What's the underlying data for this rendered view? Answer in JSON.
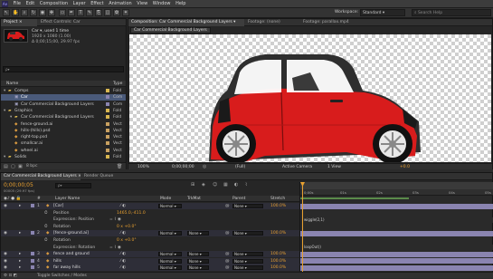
{
  "menu": {
    "logo": "Ae",
    "items": [
      "File",
      "Edit",
      "Composition",
      "Layer",
      "Effect",
      "Animation",
      "View",
      "Window",
      "Help"
    ]
  },
  "toolbar": {
    "workspace_label": "Workspace:",
    "workspace_value": "Standard",
    "search_placeholder": "Search Help"
  },
  "project": {
    "tabs": [
      "Project ×",
      "Effect Controls: Car"
    ],
    "selected_name": "Car ▾, used 1 time",
    "selected_dims": "1920 x 1080 (1.00)",
    "selected_duration": "Δ 0;00;15;00, 29.97 fps",
    "search_placeholder": "ρ▾",
    "col_name": "Name",
    "col_type": "Type",
    "items": [
      {
        "indent": 0,
        "kind": "folder",
        "name": "Comps",
        "type": "Fold"
      },
      {
        "indent": 1,
        "kind": "comp",
        "name": "Car",
        "type": "Com",
        "selected": true
      },
      {
        "indent": 1,
        "kind": "comp",
        "name": "Car Commercial Background Layers",
        "type": "Com"
      },
      {
        "indent": 0,
        "kind": "folder",
        "name": "Graphics",
        "type": "Fold"
      },
      {
        "indent": 1,
        "kind": "folder",
        "name": "Car Commercial Background Layers",
        "type": "Fold"
      },
      {
        "indent": 1,
        "kind": "file",
        "name": "fence-ground.ai",
        "type": "Vect"
      },
      {
        "indent": 1,
        "kind": "file",
        "name": "hills-(hills).psd",
        "type": "Vect"
      },
      {
        "indent": 1,
        "kind": "file",
        "name": "right-top.psd",
        "type": "Vect"
      },
      {
        "indent": 1,
        "kind": "file",
        "name": "smallcar.ai",
        "type": "Vect"
      },
      {
        "indent": 1,
        "kind": "file",
        "name": "wheel.ai",
        "type": "Vect"
      },
      {
        "indent": 0,
        "kind": "folder",
        "name": "Solids",
        "type": "Fold"
      }
    ],
    "bpc": "8 bpc"
  },
  "viewer": {
    "tabs": [
      "Composition: Car Commercial Background Layers ▾",
      "Footage: (none)",
      "Footage: parallax.mp4"
    ],
    "breadcrumb": "Car Commercial Background Layers",
    "zoom": "100%",
    "timecode": "0;00;00;00",
    "quality": "(Full)",
    "camera": "Active Camera",
    "views": "1 View",
    "offset": "+0.0"
  },
  "timeline": {
    "tabs": [
      "Car Commercial Background Layers ×",
      "Render Queue"
    ],
    "timecode": "0;00;00;05",
    "frames": "00005 (29.97 fps)",
    "search_placeholder": "ρ▾",
    "col_num": "#",
    "col_layer_name": "Layer Name",
    "col_mode": "Mode",
    "col_trkmat": "TrkMat",
    "col_parent": "Parent",
    "col_stretch": "Stretch",
    "ruler": [
      "0;00s",
      "01s",
      "02s",
      "03s",
      "04s",
      "05s"
    ],
    "rows": [
      {
        "kind": "layer",
        "num": "1",
        "name": "[Car]",
        "mode": "Normal ▾",
        "parent": "None ▾",
        "stretch": "100.0%"
      },
      {
        "kind": "prop",
        "name": "Position",
        "value": "1465.0,-411.0",
        "orange": true
      },
      {
        "kind": "expr",
        "name": "Expression: Position",
        "expr": "wiggle(2,1)"
      },
      {
        "kind": "prop",
        "name": "Rotation",
        "value": "0 x +0.0°",
        "orange": true
      },
      {
        "kind": "layer",
        "num": "2",
        "name": "[fence-ground.ai]",
        "mode": "Normal ▾",
        "trk": "None ▾",
        "parent": "None ▾",
        "stretch": "100.0%"
      },
      {
        "kind": "prop",
        "name": "Rotation",
        "value": "0 x +0.0°",
        "orange": true
      },
      {
        "kind": "expr",
        "name": "Expression: Rotation",
        "expr": "loopOut()"
      },
      {
        "kind": "layer",
        "num": "3",
        "name": "fence and ground",
        "mode": "Normal ▾",
        "trk": "None ▾",
        "parent": "None ▾",
        "stretch": "100.0%"
      },
      {
        "kind": "layer",
        "num": "4",
        "name": "hills",
        "mode": "Normal ▾",
        "trk": "None ▾",
        "parent": "None ▾",
        "stretch": "100.0%"
      },
      {
        "kind": "layer",
        "num": "5",
        "name": "far away hills",
        "mode": "Normal ▾",
        "trk": "None ▾",
        "parent": "None ▾",
        "stretch": "100.0%"
      }
    ],
    "footer": "Toggle Switches / Modes"
  },
  "colors": {
    "accent_orange": "#e8a030",
    "track_purple": "#8a84b0",
    "track_green": "#5a8a4a",
    "car_red": "#d81c1c",
    "car_dark": "#2e2e2e"
  }
}
